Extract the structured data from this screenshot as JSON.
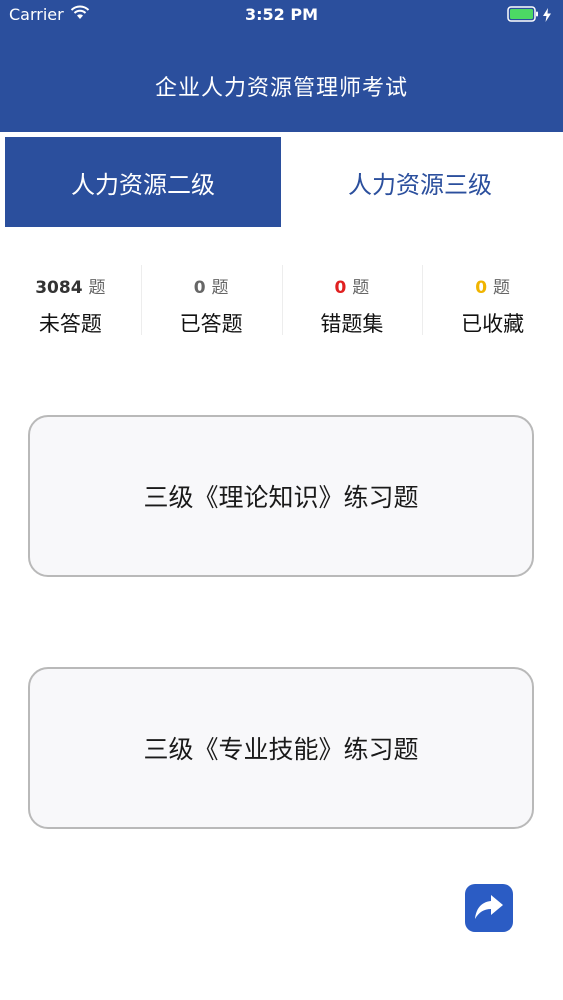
{
  "status_bar": {
    "carrier": "Carrier",
    "time": "3:52 PM"
  },
  "nav": {
    "title": "企业人力资源管理师考试"
  },
  "tabs": [
    {
      "label": "人力资源二级",
      "active": true
    },
    {
      "label": "人力资源三级",
      "active": false
    }
  ],
  "stats": [
    {
      "count": "3084",
      "unit": "题",
      "label": "未答题",
      "color": "#333333"
    },
    {
      "count": "0",
      "unit": "题",
      "label": "已答题",
      "color": "#666666"
    },
    {
      "count": "0",
      "unit": "题",
      "label": "错题集",
      "color": "#e02020"
    },
    {
      "count": "0",
      "unit": "题",
      "label": "已收藏",
      "color": "#f0b400"
    }
  ],
  "practice": {
    "theory_label": "三级《理论知识》练习题",
    "skill_label": "三级《专业技能》练习题"
  },
  "icons": {
    "wifi": "wifi-icon",
    "battery": "battery-icon",
    "share": "share-icon"
  },
  "colors": {
    "primary": "#2b4f9d",
    "share": "#2b5cc4",
    "battery": "#4cd964"
  }
}
